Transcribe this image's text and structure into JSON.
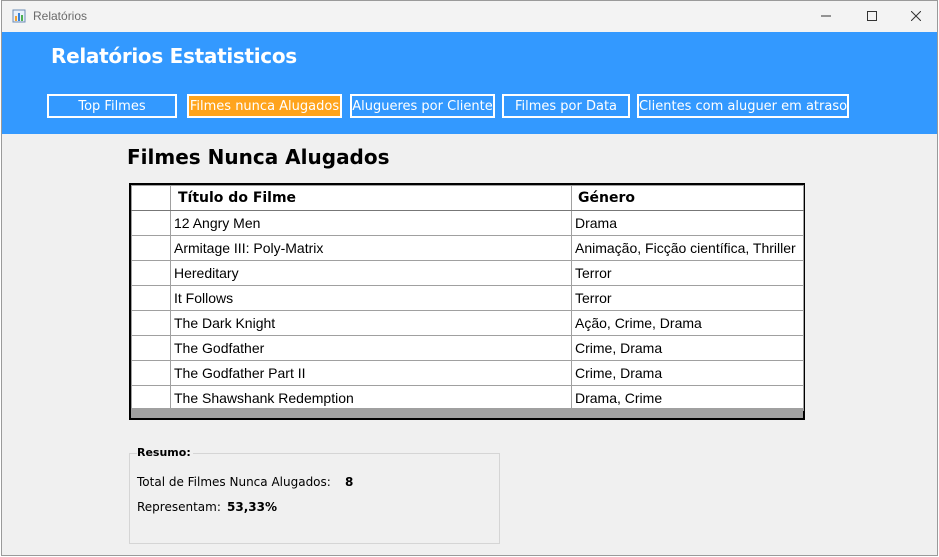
{
  "window": {
    "title": "Relatórios",
    "icon": "chart-app-icon"
  },
  "controls": {
    "minimize_icon": "minimize-icon",
    "maximize_icon": "maximize-icon",
    "close_icon": "close-icon"
  },
  "header": {
    "title": "Relatórios Estatisticos",
    "background": "#3399ff"
  },
  "nav": {
    "buttons": [
      {
        "label": "Top Filmes"
      },
      {
        "label": "Filmes nunca Alugados",
        "active": true
      },
      {
        "label": "Alugueres por Cliente"
      },
      {
        "label": "Filmes por Data"
      },
      {
        "label": "Clientes com aluguer em atraso"
      }
    ],
    "active_color": "#ffa41c"
  },
  "page_title": "Filmes Nunca Alugados",
  "table": {
    "columns": [
      "Título do Filme",
      "Género"
    ],
    "rows": [
      [
        "12 Angry Men",
        "Drama"
      ],
      [
        "Armitage III: Poly-Matrix",
        "Animação, Ficção científica, Thriller"
      ],
      [
        "Hereditary",
        "Terror"
      ],
      [
        "It Follows",
        "Terror"
      ],
      [
        "The Dark Knight",
        "Ação, Crime, Drama"
      ],
      [
        "The Godfather",
        "Crime, Drama"
      ],
      [
        "The Godfather Part II",
        "Crime, Drama"
      ],
      [
        "The Shawshank Redemption",
        "Drama, Crime"
      ]
    ]
  },
  "summary": {
    "legend": "Resumo:",
    "total_label": "Total de Filmes Nunca Alugados:",
    "total_value": "8",
    "percent_label": "Representam:",
    "percent_value": "53,33%"
  }
}
